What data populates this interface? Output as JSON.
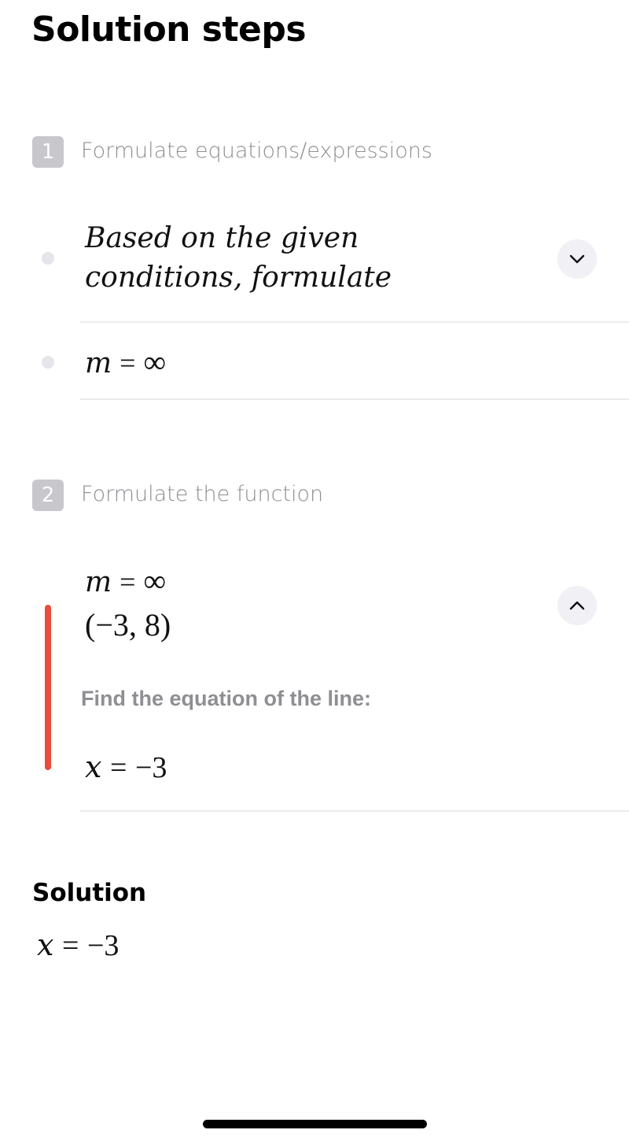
{
  "page": {
    "title": "Solution steps"
  },
  "steps": [
    {
      "number": "1",
      "title": "Formulate equations/expressions",
      "items": [
        {
          "text_line1": "Based on the given",
          "text_line2": "conditions,  formulate",
          "toggle": "chevron-down-icon"
        },
        {
          "expr": {
            "lhs": "m",
            "op": "=",
            "rhs": "∞"
          }
        }
      ]
    },
    {
      "number": "2",
      "title": "Formulate the function",
      "expanded": {
        "line1": {
          "lhs": "m",
          "op": "=",
          "rhs": "∞"
        },
        "line2": "(−3, 8)",
        "label": "Find the equation of the line:",
        "result": {
          "lhs": "x",
          "op": "=",
          "rhs": "−3"
        },
        "toggle": "chevron-up-icon"
      }
    }
  ],
  "solution": {
    "heading": "Solution",
    "result": {
      "lhs": "x",
      "op": "=",
      "rhs": "−3"
    }
  },
  "colors": {
    "accent_bar": "#e74c3c",
    "badge": "#c7c7cc",
    "muted_text": "#8e8e93"
  }
}
